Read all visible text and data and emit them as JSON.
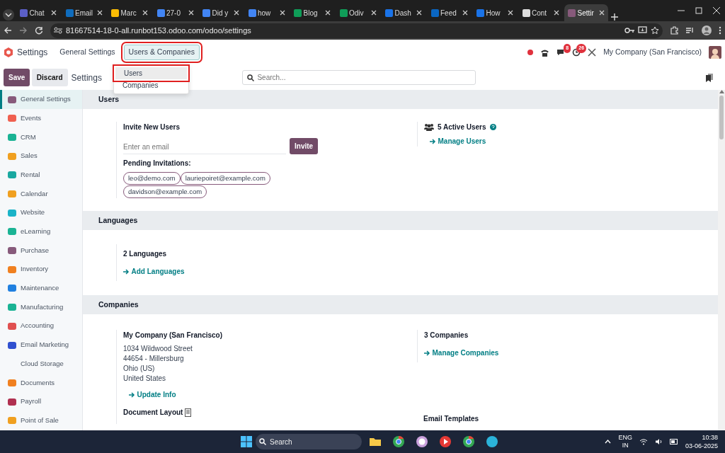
{
  "browser": {
    "tabs": [
      {
        "label": "Chat",
        "color": "#5b5fc7",
        "selected": false
      },
      {
        "label": "Email",
        "color": "#0f6cbd",
        "selected": false
      },
      {
        "label": "Marc",
        "color": "#fbbc04",
        "selected": false
      },
      {
        "label": "27-0",
        "color": "#4285f4",
        "selected": false
      },
      {
        "label": "Did y",
        "color": "#4285f4",
        "selected": false
      },
      {
        "label": "how",
        "color": "#4285f4",
        "selected": false
      },
      {
        "label": "Blog",
        "color": "#0f9d58",
        "selected": false
      },
      {
        "label": "Odiv",
        "color": "#0f9d58",
        "selected": false
      },
      {
        "label": "Dash",
        "color": "#1a73e8",
        "selected": false
      },
      {
        "label": "Feed",
        "color": "#0a66c2",
        "selected": false
      },
      {
        "label": "How",
        "color": "#1a73e8",
        "selected": false
      },
      {
        "label": "Cont",
        "color": "#dddddd",
        "selected": false
      },
      {
        "label": "Settir",
        "color": "#875a7b",
        "selected": true
      }
    ],
    "url": "81667514-18-0-all.runbot153.odoo.com/odoo/settings"
  },
  "app": {
    "title": "Settings",
    "menu": [
      {
        "label": "General Settings",
        "selected": false,
        "highlighted": false
      },
      {
        "label": "Users & Companies",
        "selected": true,
        "highlighted": true
      }
    ],
    "badges": [
      "8",
      "26"
    ],
    "company": "My Company (San Francisco)"
  },
  "toolbar": {
    "save": "Save",
    "discard": "Discard",
    "title": "Settings",
    "search_placeholder": "Search..."
  },
  "dropdown": [
    {
      "label": "Users",
      "selected": true,
      "highlighted": true
    },
    {
      "label": "Companies",
      "selected": false,
      "highlighted": false
    }
  ],
  "sidebar": [
    {
      "label": "General Settings",
      "color": "#875a7b",
      "selected": true
    },
    {
      "label": "Events",
      "color": "#f06050",
      "selected": false
    },
    {
      "label": "CRM",
      "color": "#1ab394",
      "selected": false
    },
    {
      "label": "Sales",
      "color": "#f0a020",
      "selected": false
    },
    {
      "label": "Rental",
      "color": "#1aa8a0",
      "selected": false
    },
    {
      "label": "Calendar",
      "color": "#f0a020",
      "selected": false
    },
    {
      "label": "Website",
      "color": "#1ab3c8",
      "selected": false
    },
    {
      "label": "eLearning",
      "color": "#1ab394",
      "selected": false
    },
    {
      "label": "Purchase",
      "color": "#875a7b",
      "selected": false
    },
    {
      "label": "Inventory",
      "color": "#f08020",
      "selected": false
    },
    {
      "label": "Maintenance",
      "color": "#2080e0",
      "selected": false
    },
    {
      "label": "Manufacturing",
      "color": "#1ab394",
      "selected": false
    },
    {
      "label": "Accounting",
      "color": "#e05050",
      "selected": false
    },
    {
      "label": "Email Marketing",
      "color": "#3050d0",
      "selected": false
    },
    {
      "label": "Cloud Storage",
      "selected": false
    },
    {
      "label": "Documents",
      "color": "#f08020",
      "selected": false
    },
    {
      "label": "Payroll",
      "color": "#b03050",
      "selected": false
    },
    {
      "label": "Point of Sale",
      "color": "#f0a020",
      "selected": false
    }
  ],
  "users": {
    "title": "Users",
    "invite_label": "Invite New Users",
    "email_placeholder": "Enter an email",
    "invite_button": "Invite",
    "pending_label": "Pending Invitations:",
    "pending": [
      "leo@demo.com",
      "lauriepoiret@example.com",
      "davidson@example.com"
    ],
    "active_users": "5 Active Users",
    "manage": "Manage Users"
  },
  "languages": {
    "title": "Languages",
    "count": "2 Languages",
    "add": "Add Languages"
  },
  "companies": {
    "title": "Companies",
    "name": "My Company (San Francisco)",
    "address": [
      "1034 Wildwood Street",
      "44654 - Millersburg",
      "Ohio (US)",
      "United States"
    ],
    "update": "Update Info",
    "count": "3 Companies",
    "manage": "Manage Companies",
    "document_layout": "Document Layout",
    "email_templates": "Email Templates"
  },
  "taskbar": {
    "search": "Search",
    "lang": "ENG",
    "region": "IN",
    "time": "10:38",
    "date": "03-06-2025"
  }
}
